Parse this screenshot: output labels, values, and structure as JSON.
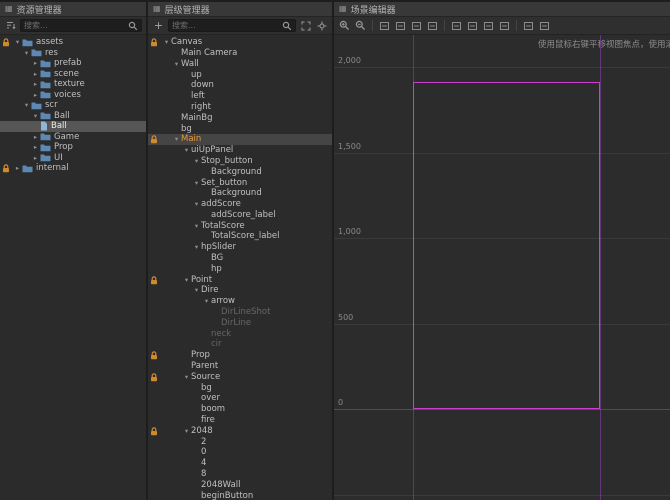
{
  "assets_panel": {
    "title": "资源管理器",
    "search_placeholder": "搜索...",
    "tree": [
      {
        "label": "assets",
        "depth": 0,
        "arrow": "open",
        "icon": "folder",
        "root": true
      },
      {
        "label": "res",
        "depth": 1,
        "arrow": "open",
        "icon": "folder"
      },
      {
        "label": "prefab",
        "depth": 2,
        "arrow": "closed",
        "icon": "folder"
      },
      {
        "label": "scene",
        "depth": 2,
        "arrow": "closed",
        "icon": "folder"
      },
      {
        "label": "texture",
        "depth": 2,
        "arrow": "closed",
        "icon": "folder"
      },
      {
        "label": "voices",
        "depth": 2,
        "arrow": "closed",
        "icon": "folder"
      },
      {
        "label": "scr",
        "depth": 1,
        "arrow": "open",
        "icon": "folder"
      },
      {
        "label": "Ball",
        "depth": 2,
        "arrow": "open",
        "icon": "folder"
      },
      {
        "label": "Ball",
        "depth": 3,
        "arrow": null,
        "icon": "file",
        "selected": true
      },
      {
        "label": "Game",
        "depth": 2,
        "arrow": "closed",
        "icon": "folder"
      },
      {
        "label": "Prop",
        "depth": 2,
        "arrow": "closed",
        "icon": "folder"
      },
      {
        "label": "UI",
        "depth": 2,
        "arrow": "closed",
        "icon": "folder"
      },
      {
        "label": "internal",
        "depth": 0,
        "arrow": "closed",
        "icon": "folder",
        "root": true
      }
    ]
  },
  "hierarchy_panel": {
    "title": "层级管理器",
    "create_button": "+",
    "search_placeholder": "搜索...",
    "tree": [
      {
        "label": "Canvas",
        "depth": 0,
        "arrow": "open",
        "lock": true
      },
      {
        "label": "Main Camera",
        "depth": 1
      },
      {
        "label": "Wall",
        "depth": 1,
        "arrow": "open"
      },
      {
        "label": "up",
        "depth": 2
      },
      {
        "label": "down",
        "depth": 2
      },
      {
        "label": "left",
        "depth": 2
      },
      {
        "label": "right",
        "depth": 2
      },
      {
        "label": "MainBg",
        "depth": 1
      },
      {
        "label": "bg",
        "depth": 1
      },
      {
        "label": "Main",
        "depth": 1,
        "arrow": "open",
        "lock": true,
        "selected": true,
        "orange": true
      },
      {
        "label": "uiUpPanel",
        "depth": 2,
        "arrow": "open"
      },
      {
        "label": "Stop_button",
        "depth": 3,
        "arrow": "open"
      },
      {
        "label": "Background",
        "depth": 4
      },
      {
        "label": "Set_button",
        "depth": 3,
        "arrow": "open"
      },
      {
        "label": "Background",
        "depth": 4
      },
      {
        "label": "addScore",
        "depth": 3,
        "arrow": "open"
      },
      {
        "label": "addScore_label",
        "depth": 4
      },
      {
        "label": "TotalScore",
        "depth": 3,
        "arrow": "open"
      },
      {
        "label": "TotalScore_label",
        "depth": 4
      },
      {
        "label": "hpSlider",
        "depth": 3,
        "arrow": "open"
      },
      {
        "label": "BG",
        "depth": 4
      },
      {
        "label": "hp",
        "depth": 4
      },
      {
        "label": "Point",
        "depth": 2,
        "arrow": "open",
        "lock": true
      },
      {
        "label": "Dire",
        "depth": 3,
        "arrow": "open"
      },
      {
        "label": "arrow",
        "depth": 4,
        "arrow": "open"
      },
      {
        "label": "DirLineShot",
        "depth": 5,
        "dim": true
      },
      {
        "label": "DirLine",
        "depth": 5,
        "dim": true
      },
      {
        "label": "neck",
        "depth": 4,
        "dim": true
      },
      {
        "label": "cir",
        "depth": 4,
        "dim": true
      },
      {
        "label": "Prop",
        "depth": 2,
        "lock": true
      },
      {
        "label": "Parent",
        "depth": 2
      },
      {
        "label": "Source",
        "depth": 2,
        "arrow": "open",
        "lock": true
      },
      {
        "label": "bg",
        "depth": 3
      },
      {
        "label": "over",
        "depth": 3
      },
      {
        "label": "boom",
        "depth": 3
      },
      {
        "label": "fire",
        "depth": 3
      },
      {
        "label": "2048",
        "depth": 2,
        "arrow": "open",
        "lock": true
      },
      {
        "label": "2",
        "depth": 3
      },
      {
        "label": "0",
        "depth": 3
      },
      {
        "label": "4",
        "depth": 3
      },
      {
        "label": "8",
        "depth": 3
      },
      {
        "label": "2048Wall",
        "depth": 3
      },
      {
        "label": "beginButton",
        "depth": 3
      }
    ]
  },
  "scene_panel": {
    "title": "场景编辑器",
    "hint": "使用鼠标右键平移视图焦点，使用滚轮缩放视图",
    "ruler_values": [
      "2,000",
      "1,500",
      "1,000",
      "500",
      "0"
    ],
    "toolbar_icons": [
      "zoom-in",
      "zoom-out",
      "sep",
      "tool",
      "tool",
      "tool",
      "tool",
      "sep",
      "tool",
      "tool",
      "tool",
      "tool",
      "sep",
      "tool",
      "tool"
    ]
  },
  "colors": {
    "asset_selection": "#565656",
    "node_selection": "#454545",
    "accent_orange": "#e39a3b",
    "folder_blue": "#5d88b3",
    "scene_rect_magenta": "#cc3ecc",
    "scene_guide_purple": "#8a47b0"
  }
}
